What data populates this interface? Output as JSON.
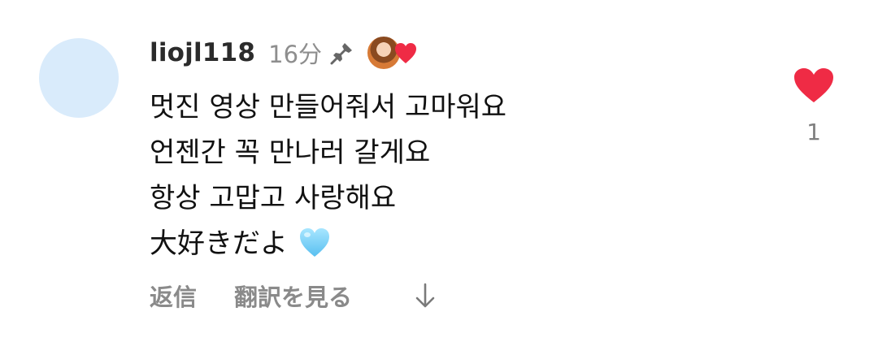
{
  "comment": {
    "username": "liojl118",
    "time": "16分",
    "lines": [
      "멋진 영상 만들어줘서 고마워요",
      "언젠간 꼭 만나러 갈게요",
      "항상 고맙고 사랑해요",
      "大好きだよ"
    ],
    "emoji_icon": "blue-heart-icon"
  },
  "actions": {
    "reply": "返信",
    "translate": "翻訳を見る",
    "expand_icon": "down-arrow-icon"
  },
  "like": {
    "count": "1",
    "icon": "heart-icon",
    "color": "#ef2b45"
  },
  "indicators": {
    "pinned_icon": "pin-icon",
    "creator_liked_icon": "creator-liked-heart-icon"
  },
  "colors": {
    "avatar": "#d9ebfb",
    "secondary_text": "#8e8e8e",
    "heart": "#ef2b45",
    "blue_heart": "#72c9f6"
  }
}
